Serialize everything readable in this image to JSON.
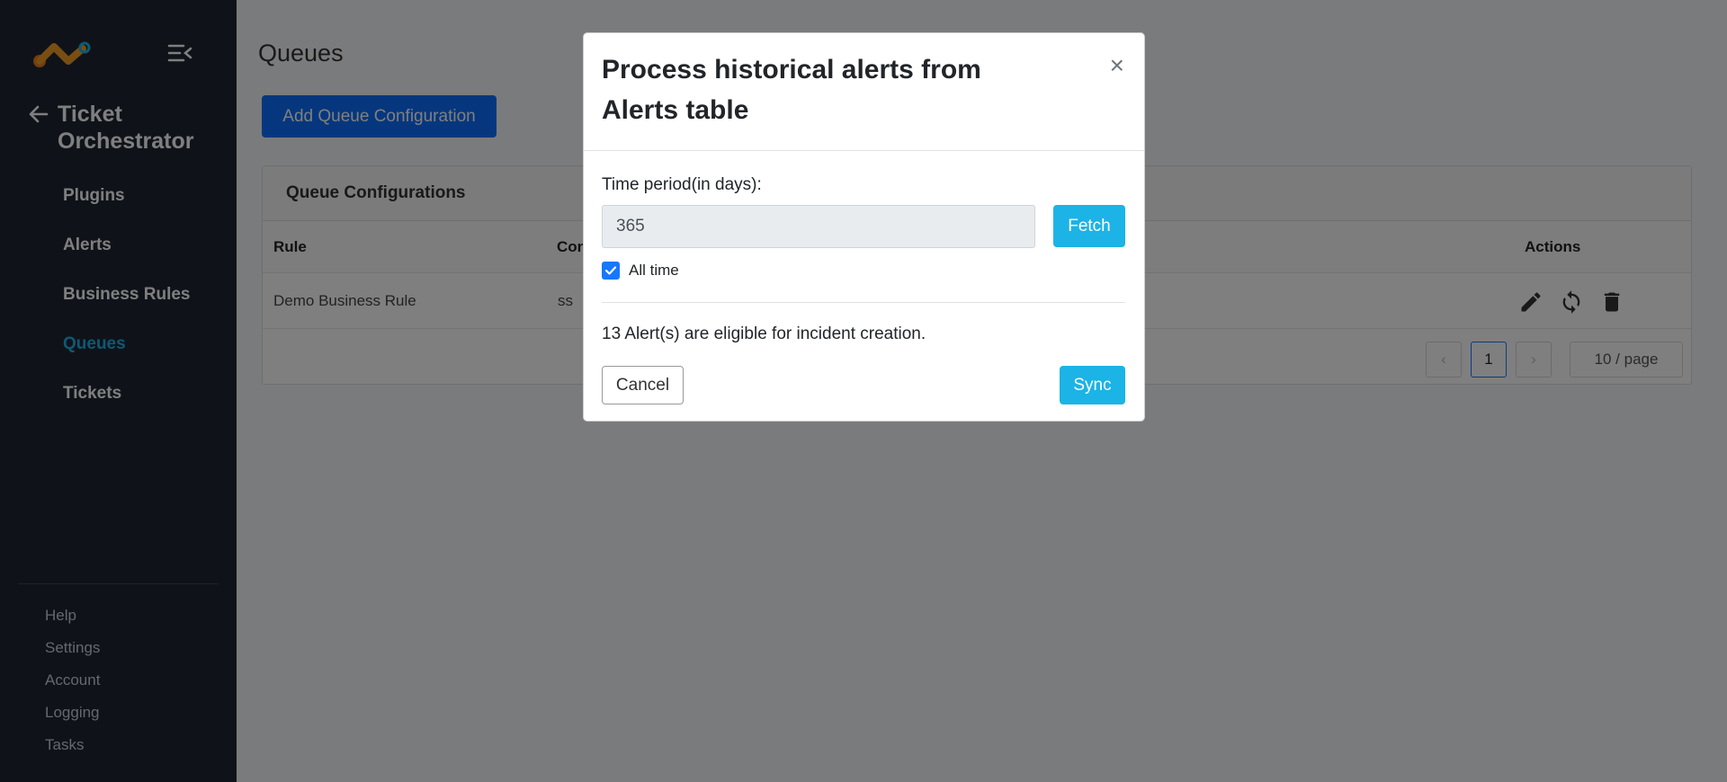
{
  "sidebar": {
    "app_title": "Ticket Orchestrator",
    "nav": [
      "Plugins",
      "Alerts",
      "Business Rules",
      "Queues",
      "Tickets"
    ],
    "active": "Queues",
    "bottom_nav": [
      "Help",
      "Settings",
      "Account",
      "Logging",
      "Tasks"
    ]
  },
  "main": {
    "page_title": "Queues",
    "add_button": "Add Queue Configuration",
    "card_title": "Queue Configurations",
    "columns": {
      "rule": "Rule",
      "con": "Con",
      "actions": "Actions"
    },
    "row": {
      "rule": "Demo Business Rule",
      "con": "ss"
    },
    "pagination": {
      "prev": "‹",
      "current": "1",
      "next": "›",
      "page_size": "10 / page"
    }
  },
  "modal": {
    "title": "Process historical alerts from Alerts table",
    "close": "×",
    "time_label": "Time period(in days):",
    "days_value": "365",
    "fetch": "Fetch",
    "all_time_label": "All time",
    "all_time_checked": true,
    "eligible_text": "13 Alert(s) are eligible for incident creation.",
    "cancel": "Cancel",
    "sync": "Sync"
  },
  "colors": {
    "sidebar_bg": "#1f2732",
    "accent": "#1cb3e6",
    "primary": "#0d6efd"
  }
}
